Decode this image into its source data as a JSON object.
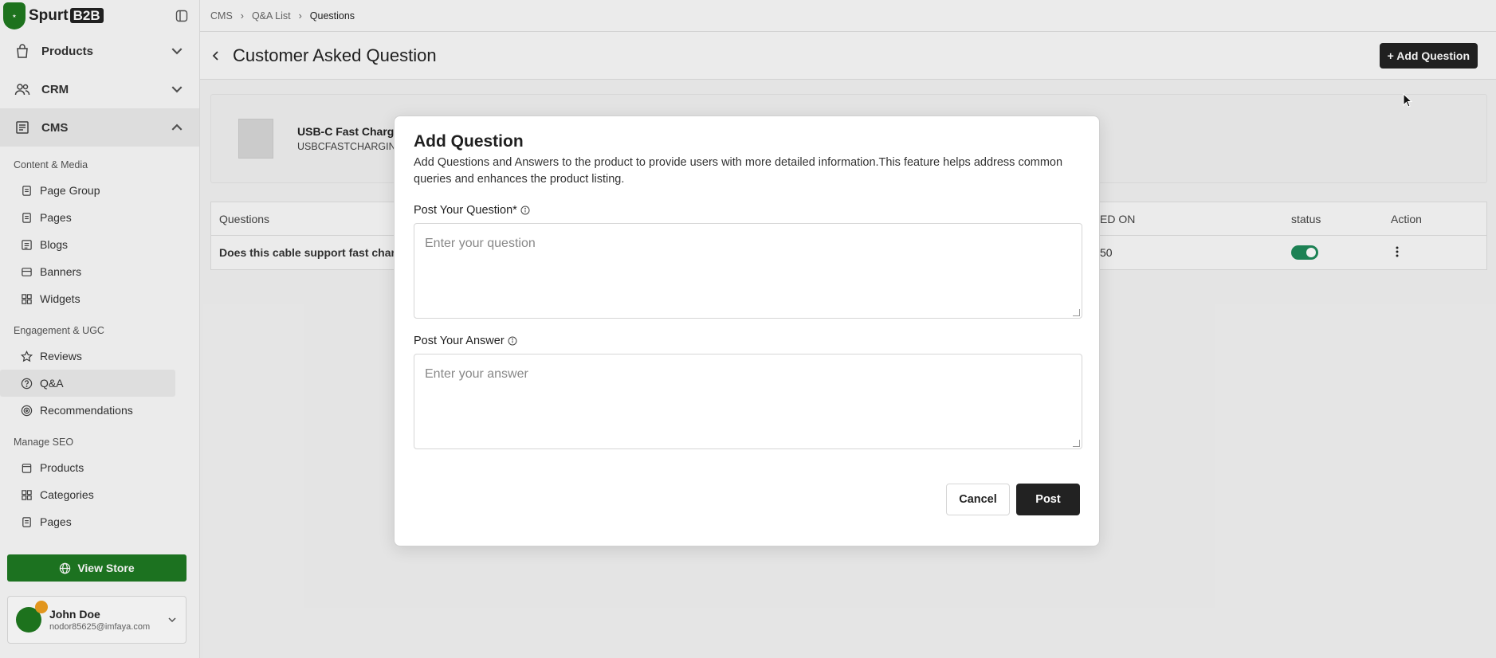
{
  "brand": {
    "name": "Spurt",
    "suffix": "B2B"
  },
  "sidebar": {
    "top_items": [
      {
        "label": "Products"
      },
      {
        "label": "CRM"
      },
      {
        "label": "CMS"
      }
    ],
    "sections": [
      {
        "label": "Content & Media",
        "items": [
          "Page Group",
          "Pages",
          "Blogs",
          "Banners",
          "Widgets"
        ]
      },
      {
        "label": "Engagement & UGC",
        "items": [
          "Reviews",
          "Q&A",
          "Recommendations"
        ]
      },
      {
        "label": "Manage SEO",
        "items": [
          "Products",
          "Categories",
          "Pages"
        ]
      }
    ],
    "view_store": "View Store",
    "user": {
      "name": "John Doe",
      "email": "nodor85625@imfaya.com"
    }
  },
  "breadcrumb": [
    "CMS",
    "Q&A List",
    "Questions"
  ],
  "page": {
    "title": "Customer Asked Question",
    "add_button": "+ Add Question"
  },
  "product": {
    "name": "USB-C Fast Charg",
    "sku": "USBCFASTCHARGINC"
  },
  "table": {
    "headers": [
      "Questions",
      "ED ON",
      "status",
      "Action"
    ],
    "rows": [
      {
        "question": "Does this cable support fast char",
        "date": "50",
        "status_on": true
      }
    ]
  },
  "modal": {
    "title": "Add Question",
    "description": "Add Questions and Answers to the product to provide users with more detailed information.This feature helps address common queries and enhances the product listing.",
    "question_label": "Post Your Question*",
    "question_placeholder": "Enter your question",
    "answer_label": "Post Your Answer",
    "answer_placeholder": "Enter your answer",
    "cancel": "Cancel",
    "post": "Post"
  },
  "colors": {
    "brand_green": "#1e7a22",
    "dark": "#222222",
    "toggle_on": "#1e8a5a"
  }
}
